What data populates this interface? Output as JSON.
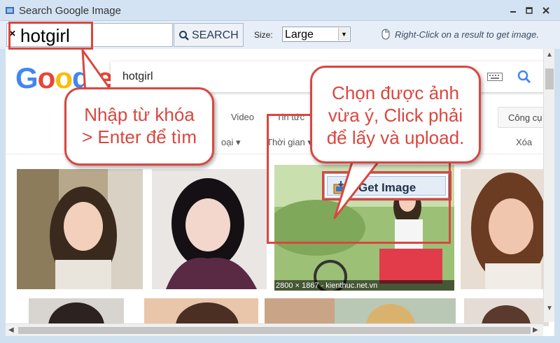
{
  "window": {
    "title": "Search Google Image"
  },
  "toolbar": {
    "clear_label": "×",
    "query": "hotgirl",
    "search_label": "SEARCH",
    "size_label": "Size:",
    "size_value": "Large",
    "hint": "Right-Click on a result to get image."
  },
  "google": {
    "logo": [
      "G",
      "o",
      "o",
      "g",
      "l",
      "e"
    ],
    "logo_colors": [
      "#4285f4",
      "#ea4335",
      "#fbbc05",
      "#4285f4",
      "#34a853",
      "#ea4335"
    ],
    "query": "hotgirl",
    "tabs": {
      "video": "Video",
      "news": "Tin tức",
      "type": "oại ▾",
      "time": "Thời gian ▾",
      "clear": "Xóa",
      "tools": "Công cụ"
    }
  },
  "results": {
    "selected_caption": "2800 × 1867 - kienthuc.net.vn"
  },
  "context_menu": {
    "get_image": "Get Image"
  },
  "annotations": {
    "left": [
      "Nhập từ khóa",
      "> Enter để tìm"
    ],
    "right": [
      "Chọn được ảnh",
      "vừa ý, Click phải",
      "để lấy và upload."
    ]
  },
  "colors": {
    "accent": "#d9473f",
    "title_bar": "#d4e3f3"
  }
}
